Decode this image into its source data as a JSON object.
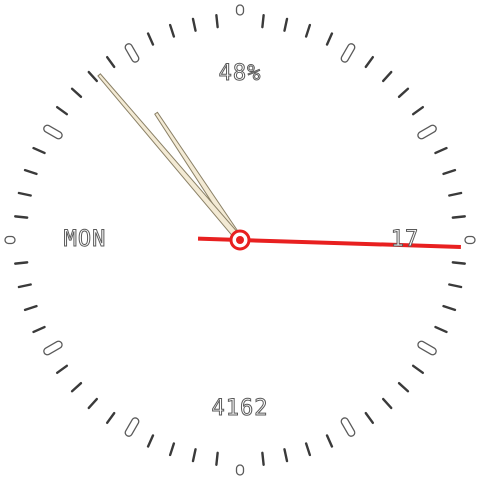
{
  "complications": {
    "battery": "48%",
    "steps": "4162",
    "weekday": "MON",
    "day": "17"
  },
  "time": {
    "hours": 10,
    "minutes": 53,
    "seconds": 15.3
  },
  "colors": {
    "tick": "#3a3a3a",
    "marker_outline": "#5a5a5a",
    "hand_fill": "#f3ead4",
    "hand_outline": "#8a8066",
    "second_hand": "#e82020"
  }
}
